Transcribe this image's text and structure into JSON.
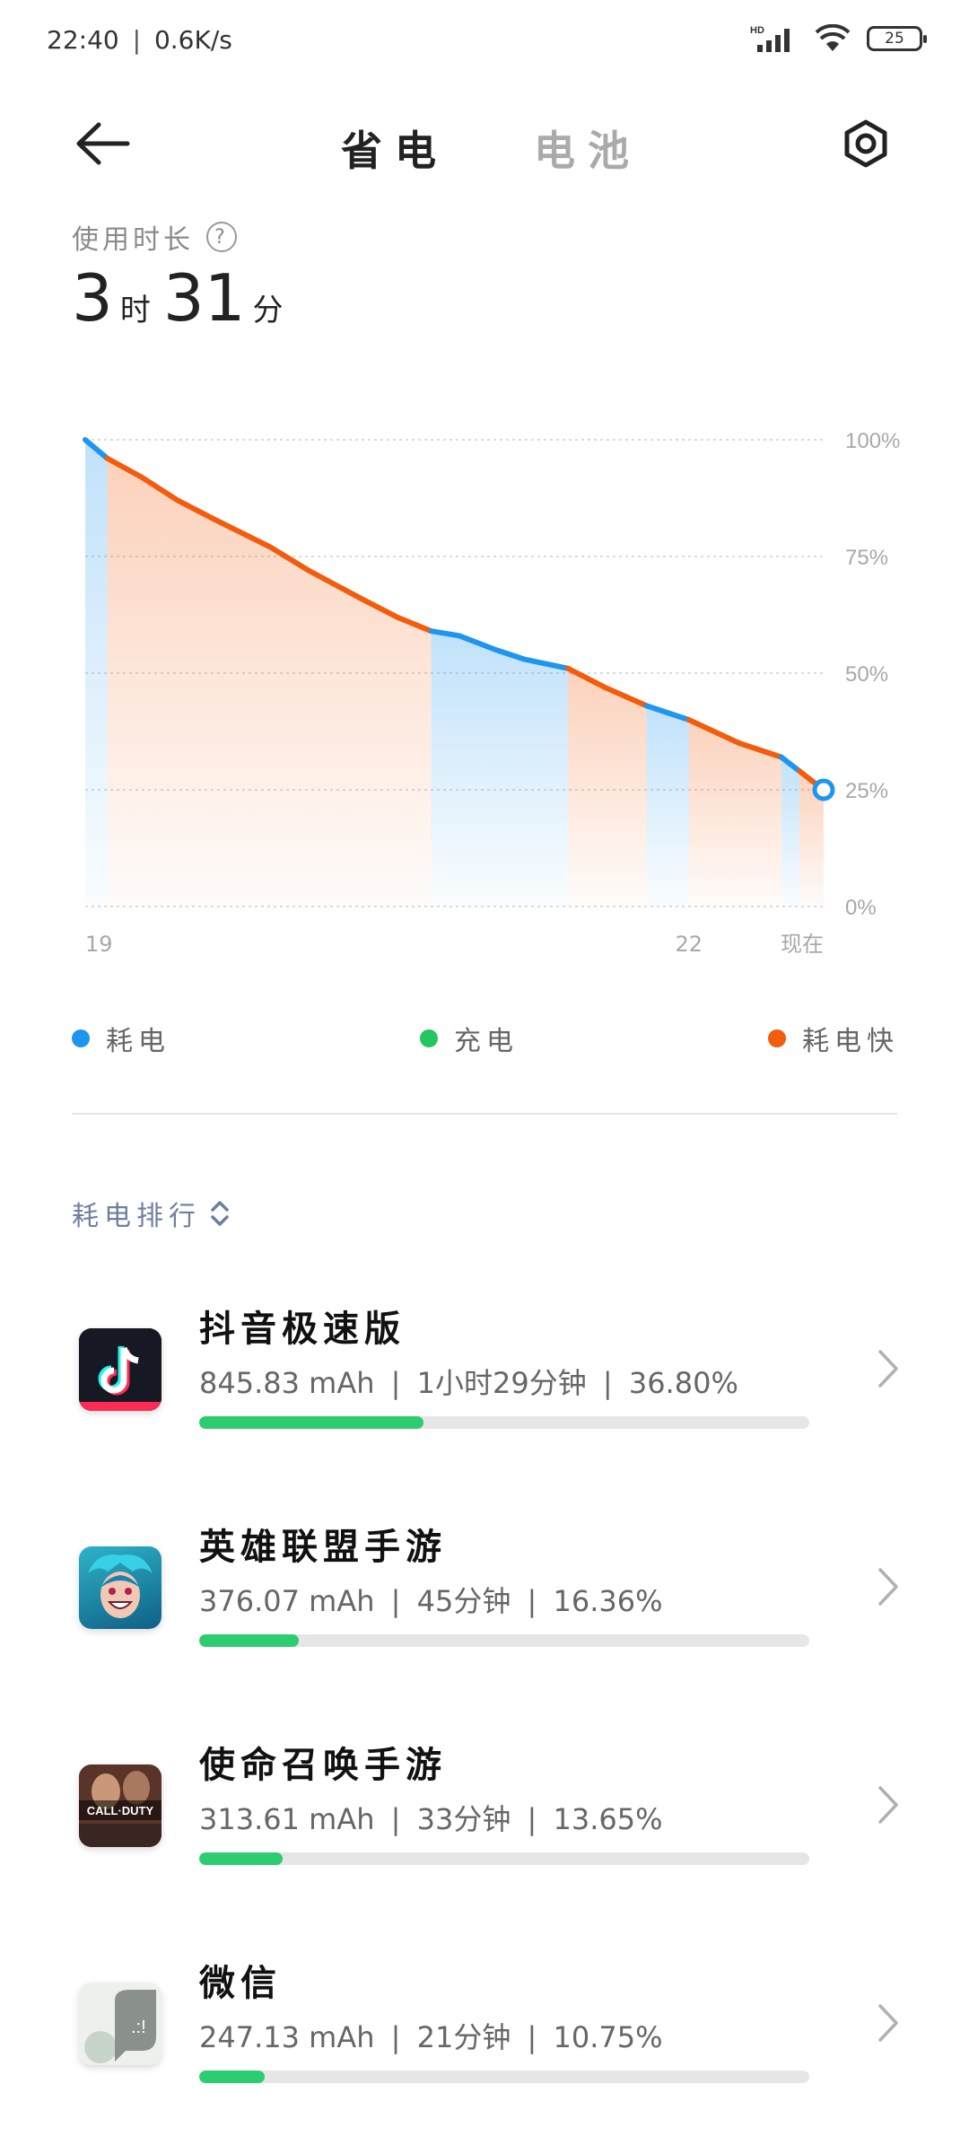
{
  "status_bar": {
    "time": "22:40",
    "separator": "|",
    "speed": "0.6K/s",
    "battery": "25",
    "network_label": "HD"
  },
  "header": {
    "tab_active": "省电",
    "tab_inactive": "电池"
  },
  "usage": {
    "label": "使用时长",
    "hours": "3",
    "hour_unit": "时",
    "minutes": "31",
    "minute_unit": "分",
    "help_symbol": "?"
  },
  "chart_data": {
    "type": "area",
    "y_ticks": [
      "100%",
      "75%",
      "50%",
      "25%",
      "0%"
    ],
    "ylim": [
      0,
      100
    ],
    "x_tick_labels": [
      "19",
      "22",
      "现在"
    ],
    "x_tick_times": [
      19.0,
      22.0,
      22.67
    ],
    "xlim": [
      19.0,
      22.67
    ],
    "grid": true,
    "series": [
      {
        "name": "耗电",
        "color": "#1e96ee"
      },
      {
        "name": "充电",
        "color": "#22c55e"
      },
      {
        "name": "耗电快",
        "color": "#f25c0d"
      }
    ],
    "points": [
      {
        "t": 19.0,
        "v": 100
      },
      {
        "t": 19.11,
        "v": 96
      },
      {
        "t": 19.28,
        "v": 92
      },
      {
        "t": 19.46,
        "v": 87
      },
      {
        "t": 19.64,
        "v": 83
      },
      {
        "t": 19.92,
        "v": 77
      },
      {
        "t": 20.11,
        "v": 72
      },
      {
        "t": 20.37,
        "v": 66
      },
      {
        "t": 20.55,
        "v": 62
      },
      {
        "t": 20.72,
        "v": 59
      },
      {
        "t": 20.86,
        "v": 58
      },
      {
        "t": 21.04,
        "v": 55
      },
      {
        "t": 21.18,
        "v": 53
      },
      {
        "t": 21.4,
        "v": 51
      },
      {
        "t": 21.58,
        "v": 47
      },
      {
        "t": 21.79,
        "v": 43
      },
      {
        "t": 22.0,
        "v": 40
      },
      {
        "t": 22.25,
        "v": 35
      },
      {
        "t": 22.46,
        "v": 32
      },
      {
        "t": 22.67,
        "v": 25
      }
    ],
    "segments": [
      {
        "from": 19.0,
        "to": 19.11,
        "type": "耗电"
      },
      {
        "from": 19.11,
        "to": 20.72,
        "type": "耗电快"
      },
      {
        "from": 20.72,
        "to": 21.4,
        "type": "耗电"
      },
      {
        "from": 21.4,
        "to": 21.79,
        "type": "耗电快"
      },
      {
        "from": 21.79,
        "to": 22.0,
        "type": "耗电"
      },
      {
        "from": 22.0,
        "to": 22.46,
        "type": "耗电快"
      },
      {
        "from": 22.46,
        "to": 22.55,
        "type": "耗电"
      },
      {
        "from": 22.55,
        "to": 22.67,
        "type": "耗电快"
      }
    ]
  },
  "ranking": {
    "label": "耗电排行",
    "sep": "|",
    "apps": [
      {
        "name": "抖音极速版",
        "mah": "845.83 mAh",
        "duration": "1小时29分钟",
        "percent": "36.80%",
        "fraction": 0.368
      },
      {
        "name": "英雄联盟手游",
        "mah": "376.07 mAh",
        "duration": "45分钟",
        "percent": "16.36%",
        "fraction": 0.1636
      },
      {
        "name": "使命召唤手游",
        "mah": "313.61 mAh",
        "duration": "33分钟",
        "percent": "13.65%",
        "fraction": 0.1365
      },
      {
        "name": "微信",
        "mah": "247.13 mAh",
        "duration": "21分钟",
        "percent": "10.75%",
        "fraction": 0.1075
      }
    ],
    "icon_texts": {
      "cod": "CALL·DUTY"
    }
  }
}
